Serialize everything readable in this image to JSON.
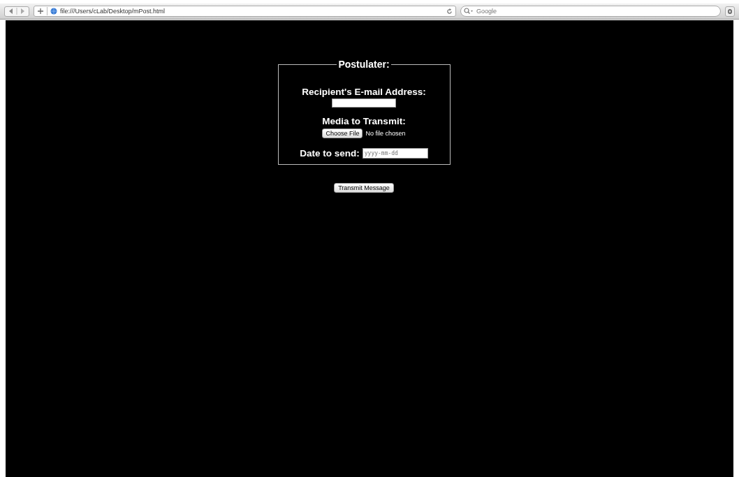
{
  "toolbar": {
    "url": "file:///Users/cLab/Desktop/mPost.html",
    "search_placeholder": "Google"
  },
  "form": {
    "legend": "Postulater:",
    "email_label": "Recipient's E-mail Address:",
    "media_label": "Media to Transmit:",
    "file_button": "Choose File",
    "file_status": "No file chosen",
    "date_label": "Date to send:",
    "date_placeholder": "yyyy-mm-dd"
  },
  "submit": "Transmit Message"
}
